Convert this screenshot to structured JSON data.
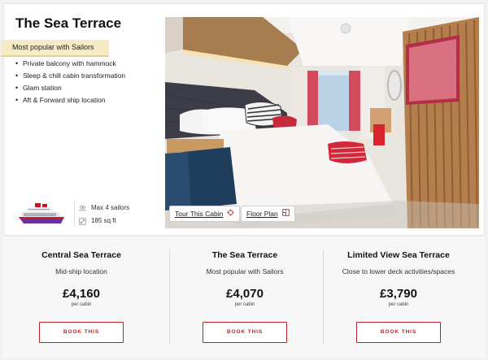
{
  "room": {
    "title": "The Sea Terrace",
    "badge": "Most popular with Sailors",
    "features": [
      "Private balcony with hammock",
      "Sleep & chill cabin transformation",
      "Glam station",
      "Aft & Forward ship location"
    ],
    "specs": {
      "capacity": "Max 4 sailors",
      "size": "185 sq ft"
    },
    "tour_button": "Tour This Cabin",
    "floor_button": "Floor Plan",
    "colors": {
      "accent": "#c0212c",
      "badge_bg": "#f7eac7",
      "headboard": "#3a3a44",
      "wall_slats": "#b08457"
    }
  },
  "options": [
    {
      "name": "Central Sea Terrace",
      "location": "Mid-ship location",
      "price": "£4,160",
      "per": "per cabin",
      "cta": "BOOK THIS"
    },
    {
      "name": "The Sea Terrace",
      "location": "Most popular with Sailors",
      "price": "£4,070",
      "per": "per cabin",
      "cta": "BOOK THIS"
    },
    {
      "name": "Limited View Sea Terrace",
      "location": "Close to lower deck activities/spaces",
      "price": "£3,790",
      "per": "per cabin",
      "cta": "BOOK THIS"
    }
  ]
}
